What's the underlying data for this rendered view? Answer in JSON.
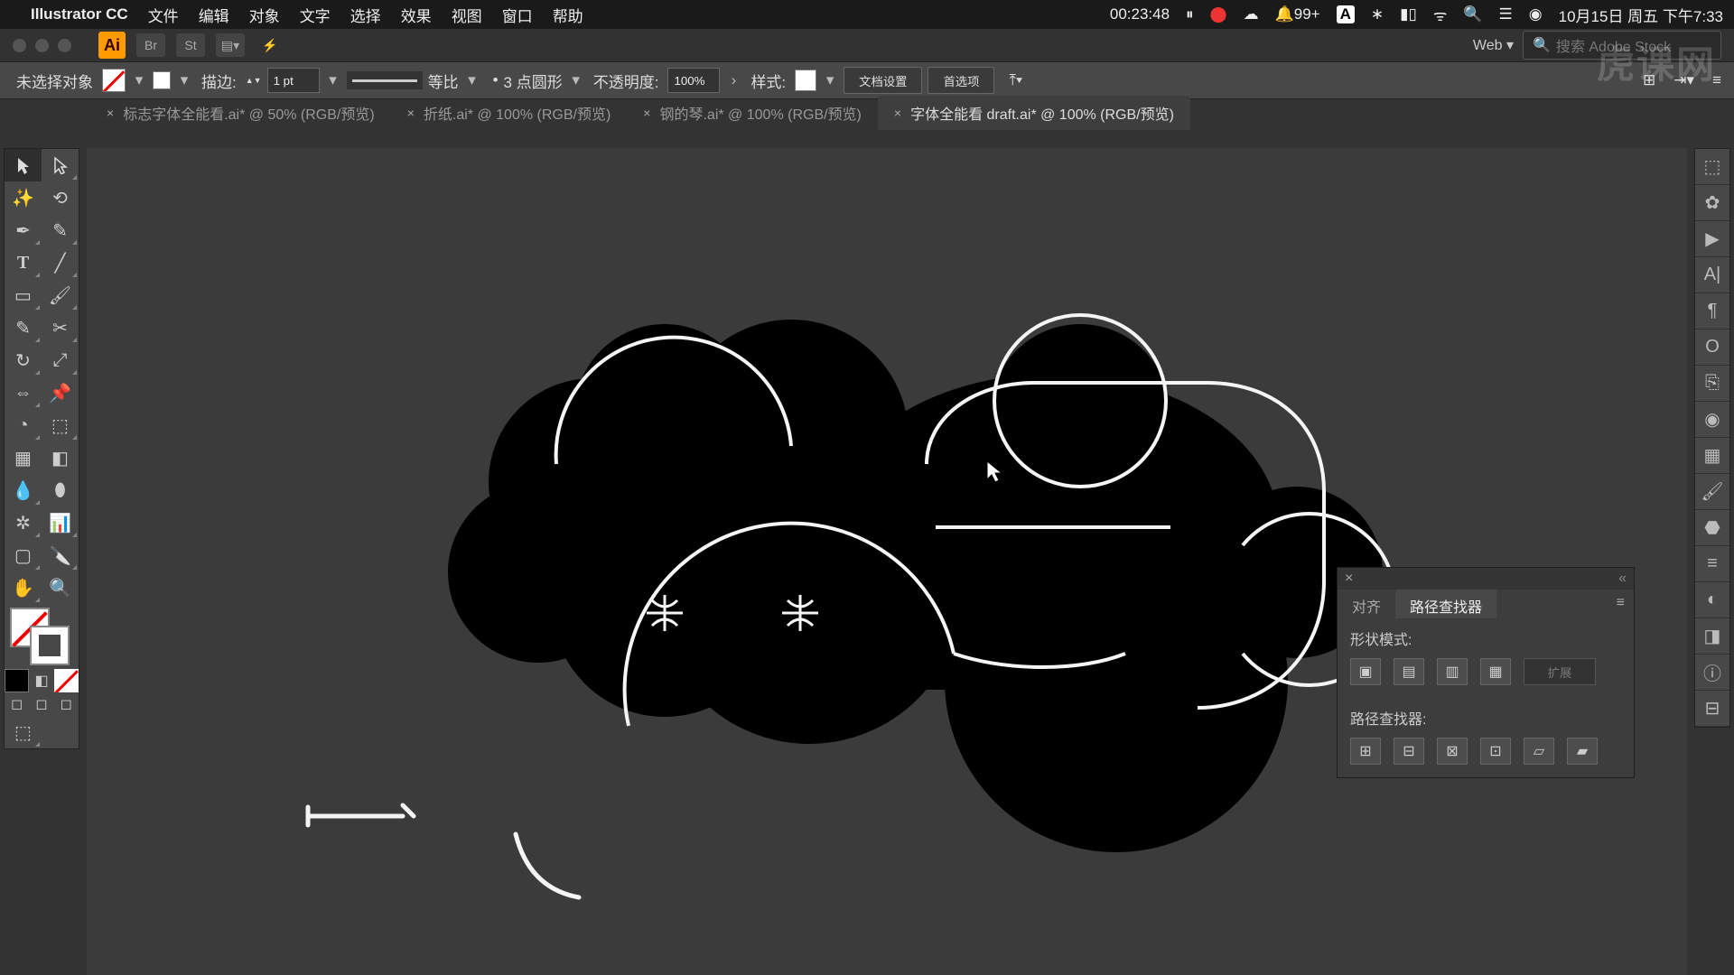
{
  "mac_menu": {
    "app_name": "Illustrator CC",
    "items": [
      "文件",
      "编辑",
      "对象",
      "文字",
      "选择",
      "效果",
      "视图",
      "窗口",
      "帮助"
    ],
    "timer": "00:23:48",
    "notif": "99+",
    "date": "10月15日 周五 下午7:33"
  },
  "app_bar": {
    "doc_mode": "Web",
    "search_placeholder": "搜索 Adobe Stock"
  },
  "control_bar": {
    "selection_label": "未选择对象",
    "stroke_label": "描边:",
    "stroke_value": "1 pt",
    "profile_label": "等比",
    "corner_label": "3 点圆形",
    "opacity_label": "不透明度:",
    "opacity_value": "100%",
    "style_label": "样式:",
    "doc_setup_btn": "文档设置",
    "prefs_btn": "首选项"
  },
  "tabs": [
    {
      "label": "标志字体全能看.ai* @ 50% (RGB/预览)"
    },
    {
      "label": "折纸.ai* @ 100% (RGB/预览)"
    },
    {
      "label": "钢的琴.ai* @ 100% (RGB/预览)"
    },
    {
      "label": "字体全能看 draft.ai* @ 100% (RGB/预览)"
    }
  ],
  "pathfinder": {
    "tab_align": "对齐",
    "tab_pathfinder": "路径查找器",
    "shape_modes_label": "形状模式:",
    "expand_btn": "扩展",
    "pathfinders_label": "路径查找器:"
  },
  "watermark": "虎课网"
}
